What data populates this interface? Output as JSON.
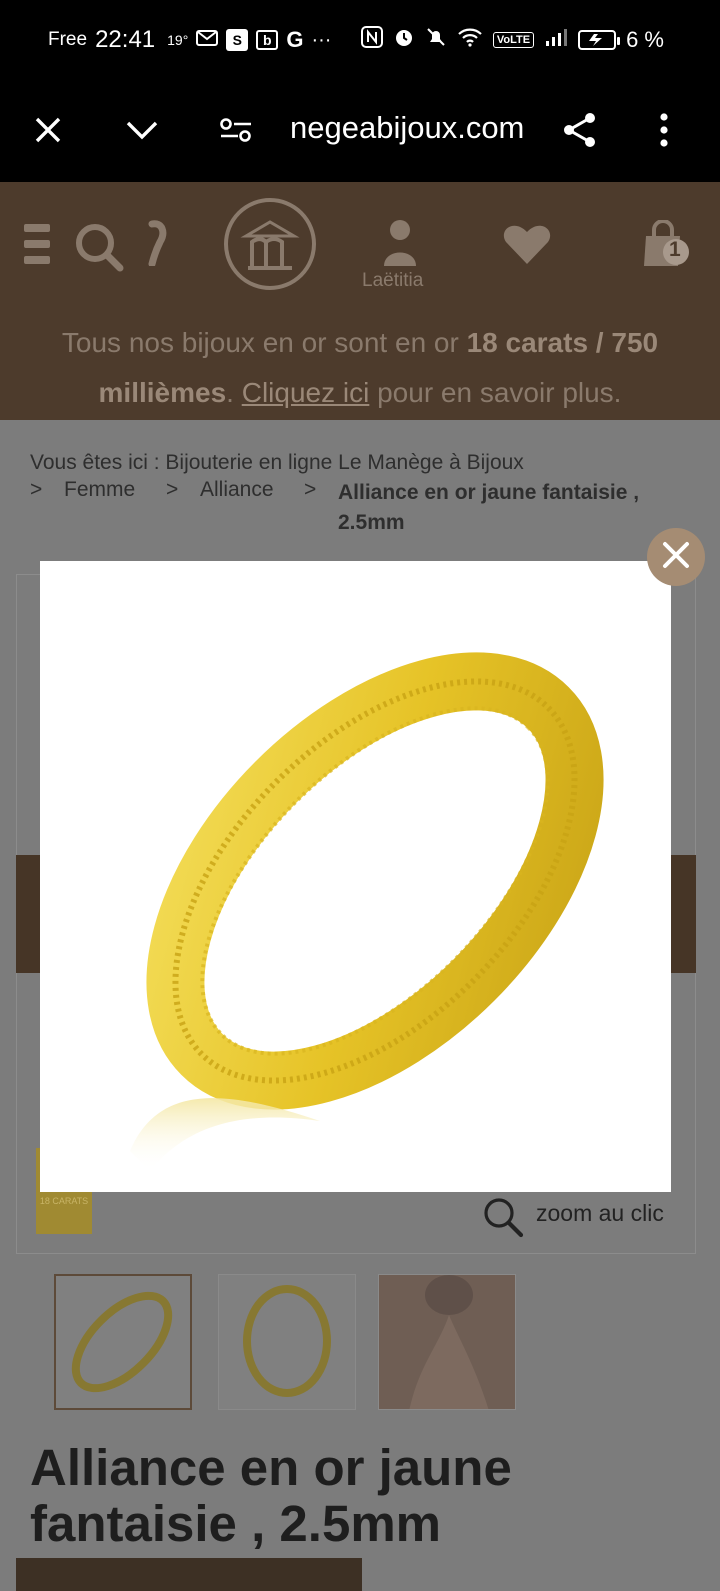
{
  "status_bar": {
    "carrier": "Free",
    "time": "22:41",
    "temperature": "19°",
    "icon_s": "S",
    "icon_b": "b",
    "icon_g": "G",
    "overflow": "···",
    "volte": "VoLTE",
    "battery": "6 %"
  },
  "browser": {
    "url": "negeabijoux.com"
  },
  "header": {
    "user_name": "Laëtitia",
    "cart_count": "1",
    "banner": {
      "prefix": "Tous nos bijoux en or sont en or ",
      "bold": "18 carats / 750 millièmes",
      "middle": ". ",
      "link": "Cliquez ici",
      "suffix": " pour en savoir plus."
    }
  },
  "breadcrumb": {
    "intro": "Vous êtes ici : Bijouterie en ligne Le Manège à Bijoux",
    "sep": ">",
    "level1": "Femme",
    "level2": "Alliance",
    "current": "Alliance en or jaune fantaisie , 2.5mm"
  },
  "gallery": {
    "zoom_label": "zoom au clic",
    "badge_text": "18 CARATS"
  },
  "product": {
    "title": "Alliance en or jaune fantaisie , 2.5mm"
  },
  "colors": {
    "header_brown": "#4d3b2c",
    "gold": "#e3c02a",
    "close_button": "#a58c73"
  },
  "icons": [
    "close-icon",
    "chevron-down-icon",
    "site-settings-icon",
    "share-icon",
    "menu-dots-icon",
    "hamburger-icon",
    "search-icon",
    "phone-icon",
    "logo-icon",
    "user-icon",
    "heart-icon",
    "bag-icon",
    "zoom-icon"
  ]
}
